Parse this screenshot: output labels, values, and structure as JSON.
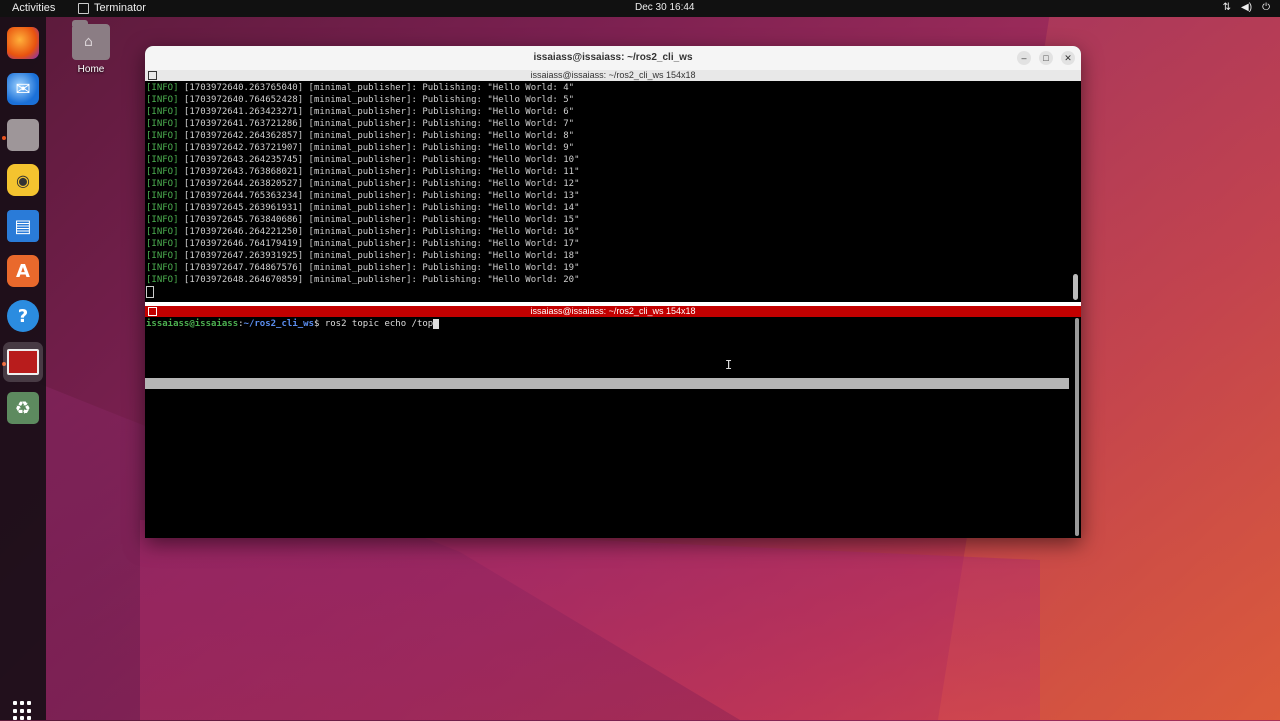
{
  "topbar": {
    "activities": "Activities",
    "app_name": "Terminator",
    "clock": "Dec 30  16:44",
    "tray_icons": [
      "network-icon",
      "volume-icon",
      "power-icon"
    ]
  },
  "dock": {
    "items": [
      "firefox-icon",
      "thunderbird-icon",
      "files-icon",
      "rhythmbox-icon",
      "writer-icon",
      "app-center-icon",
      "help-icon",
      "terminator-icon",
      "trash-icon"
    ],
    "show_apps": "show-apps-icon"
  },
  "desktop": {
    "home_label": "Home"
  },
  "window": {
    "title": "issaiass@issaiass: ~/ros2_cli_ws",
    "pane_top_title": "issaiass@issaiass: ~/ros2_cli_ws 154x18",
    "pane_bottom_title": "issaiass@issaiass: ~/ros2_cli_ws 154x18",
    "buttons": {
      "minimize": "–",
      "maximize": "□",
      "close": "✕"
    }
  },
  "log_lines": [
    {
      "tag": "[INFO]",
      "text": " [1703972640.263765040] [minimal_publisher]: Publishing: \"Hello World: 4\""
    },
    {
      "tag": "[INFO]",
      "text": " [1703972640.764652428] [minimal_publisher]: Publishing: \"Hello World: 5\""
    },
    {
      "tag": "[INFO]",
      "text": " [1703972641.263423271] [minimal_publisher]: Publishing: \"Hello World: 6\""
    },
    {
      "tag": "[INFO]",
      "text": " [1703972641.763721286] [minimal_publisher]: Publishing: \"Hello World: 7\""
    },
    {
      "tag": "[INFO]",
      "text": " [1703972642.264362857] [minimal_publisher]: Publishing: \"Hello World: 8\""
    },
    {
      "tag": "[INFO]",
      "text": " [1703972642.763721907] [minimal_publisher]: Publishing: \"Hello World: 9\""
    },
    {
      "tag": "[INFO]",
      "text": " [1703972643.264235745] [minimal_publisher]: Publishing: \"Hello World: 10\""
    },
    {
      "tag": "[INFO]",
      "text": " [1703972643.763868021] [minimal_publisher]: Publishing: \"Hello World: 11\""
    },
    {
      "tag": "[INFO]",
      "text": " [1703972644.263820527] [minimal_publisher]: Publishing: \"Hello World: 12\""
    },
    {
      "tag": "[INFO]",
      "text": " [1703972644.765363234] [minimal_publisher]: Publishing: \"Hello World: 13\""
    },
    {
      "tag": "[INFO]",
      "text": " [1703972645.263961931] [minimal_publisher]: Publishing: \"Hello World: 14\""
    },
    {
      "tag": "[INFO]",
      "text": " [1703972645.763840686] [minimal_publisher]: Publishing: \"Hello World: 15\""
    },
    {
      "tag": "[INFO]",
      "text": " [1703972646.264221250] [minimal_publisher]: Publishing: \"Hello World: 16\""
    },
    {
      "tag": "[INFO]",
      "text": " [1703972646.764179419] [minimal_publisher]: Publishing: \"Hello World: 17\""
    },
    {
      "tag": "[INFO]",
      "text": " [1703972647.263931925] [minimal_publisher]: Publishing: \"Hello World: 18\""
    },
    {
      "tag": "[INFO]",
      "text": " [1703972647.764867576] [minimal_publisher]: Publishing: \"Hello World: 19\""
    },
    {
      "tag": "[INFO]",
      "text": " [1703972648.264670859] [minimal_publisher]: Publishing: \"Hello World: 20\""
    }
  ],
  "prompt": {
    "user": "issaiass@issaiass",
    "sep": ":",
    "path": "~/ros2_cli_ws",
    "dollar": "$ ",
    "command": "ros2 topic echo /top"
  },
  "colors": {
    "info_tag": "#4caf50",
    "active_pane_bar": "#c20000",
    "accent": "#e95420"
  }
}
